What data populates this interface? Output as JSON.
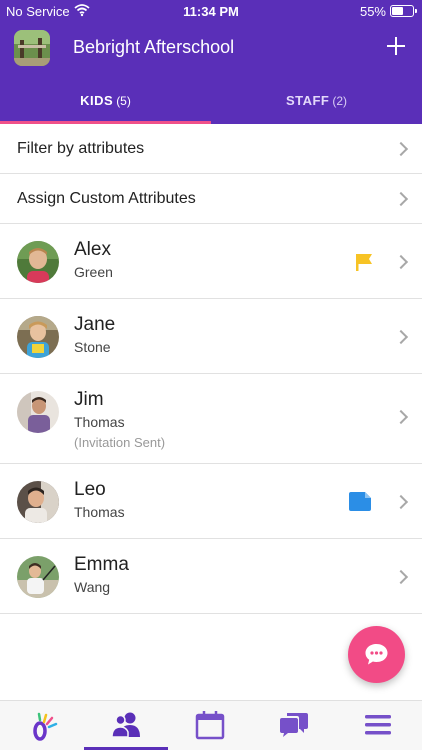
{
  "status_bar": {
    "carrier": "No Service",
    "time": "11:34 PM",
    "battery": "55%"
  },
  "header": {
    "title": "Bebright Afterschool"
  },
  "tabs": [
    {
      "name": "KIDS",
      "count": "(5)",
      "active": true
    },
    {
      "name": "STAFF",
      "count": "(2)",
      "active": false
    }
  ],
  "options": [
    {
      "label": "Filter by attributes"
    },
    {
      "label": "Assign Custom Attributes"
    }
  ],
  "kids": [
    {
      "first": "Alex",
      "last": "Green",
      "note": "",
      "badge": "flag-icon"
    },
    {
      "first": "Jane",
      "last": "Stone",
      "note": "",
      "badge": ""
    },
    {
      "first": "Jim",
      "last": "Thomas",
      "note": "(Invitation Sent)",
      "badge": ""
    },
    {
      "first": "Leo",
      "last": "Thomas",
      "note": "",
      "badge": "document-icon"
    },
    {
      "first": "Emma",
      "last": "Wang",
      "note": "",
      "badge": ""
    }
  ],
  "colors": {
    "brand": "#5a2fb8",
    "accent": "#f24b86",
    "flag": "#f7c325",
    "document": "#2b8ee6"
  },
  "bottom_nav": [
    {
      "icon": "logo-icon",
      "active": false
    },
    {
      "icon": "people-icon",
      "active": true
    },
    {
      "icon": "calendar-icon",
      "active": false
    },
    {
      "icon": "chat-icon",
      "active": false
    },
    {
      "icon": "menu-icon",
      "active": false
    }
  ]
}
